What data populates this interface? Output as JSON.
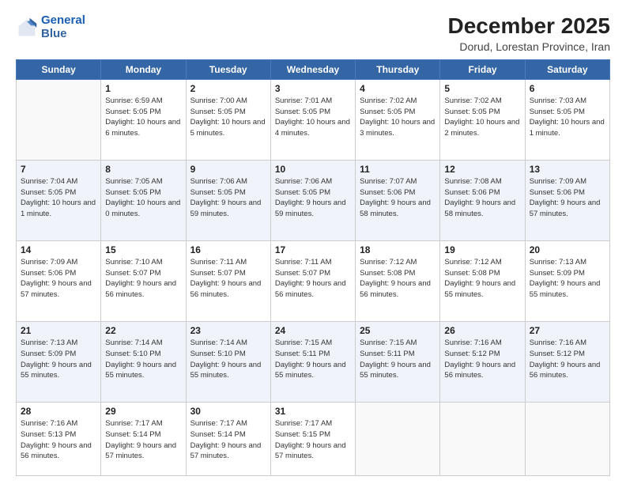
{
  "header": {
    "logo_line1": "General",
    "logo_line2": "Blue",
    "month": "December 2025",
    "location": "Dorud, Lorestan Province, Iran"
  },
  "days_of_week": [
    "Sunday",
    "Monday",
    "Tuesday",
    "Wednesday",
    "Thursday",
    "Friday",
    "Saturday"
  ],
  "weeks": [
    [
      {
        "day": null
      },
      {
        "day": "1",
        "sunrise": "6:59 AM",
        "sunset": "5:05 PM",
        "daylight": "10 hours and 6 minutes."
      },
      {
        "day": "2",
        "sunrise": "7:00 AM",
        "sunset": "5:05 PM",
        "daylight": "10 hours and 5 minutes."
      },
      {
        "day": "3",
        "sunrise": "7:01 AM",
        "sunset": "5:05 PM",
        "daylight": "10 hours and 4 minutes."
      },
      {
        "day": "4",
        "sunrise": "7:02 AM",
        "sunset": "5:05 PM",
        "daylight": "10 hours and 3 minutes."
      },
      {
        "day": "5",
        "sunrise": "7:02 AM",
        "sunset": "5:05 PM",
        "daylight": "10 hours and 2 minutes."
      },
      {
        "day": "6",
        "sunrise": "7:03 AM",
        "sunset": "5:05 PM",
        "daylight": "10 hours and 1 minute."
      }
    ],
    [
      {
        "day": "7",
        "sunrise": "7:04 AM",
        "sunset": "5:05 PM",
        "daylight": "10 hours and 1 minute."
      },
      {
        "day": "8",
        "sunrise": "7:05 AM",
        "sunset": "5:05 PM",
        "daylight": "10 hours and 0 minutes."
      },
      {
        "day": "9",
        "sunrise": "7:06 AM",
        "sunset": "5:05 PM",
        "daylight": "9 hours and 59 minutes."
      },
      {
        "day": "10",
        "sunrise": "7:06 AM",
        "sunset": "5:05 PM",
        "daylight": "9 hours and 59 minutes."
      },
      {
        "day": "11",
        "sunrise": "7:07 AM",
        "sunset": "5:06 PM",
        "daylight": "9 hours and 58 minutes."
      },
      {
        "day": "12",
        "sunrise": "7:08 AM",
        "sunset": "5:06 PM",
        "daylight": "9 hours and 58 minutes."
      },
      {
        "day": "13",
        "sunrise": "7:09 AM",
        "sunset": "5:06 PM",
        "daylight": "9 hours and 57 minutes."
      }
    ],
    [
      {
        "day": "14",
        "sunrise": "7:09 AM",
        "sunset": "5:06 PM",
        "daylight": "9 hours and 57 minutes."
      },
      {
        "day": "15",
        "sunrise": "7:10 AM",
        "sunset": "5:07 PM",
        "daylight": "9 hours and 56 minutes."
      },
      {
        "day": "16",
        "sunrise": "7:11 AM",
        "sunset": "5:07 PM",
        "daylight": "9 hours and 56 minutes."
      },
      {
        "day": "17",
        "sunrise": "7:11 AM",
        "sunset": "5:07 PM",
        "daylight": "9 hours and 56 minutes."
      },
      {
        "day": "18",
        "sunrise": "7:12 AM",
        "sunset": "5:08 PM",
        "daylight": "9 hours and 56 minutes."
      },
      {
        "day": "19",
        "sunrise": "7:12 AM",
        "sunset": "5:08 PM",
        "daylight": "9 hours and 55 minutes."
      },
      {
        "day": "20",
        "sunrise": "7:13 AM",
        "sunset": "5:09 PM",
        "daylight": "9 hours and 55 minutes."
      }
    ],
    [
      {
        "day": "21",
        "sunrise": "7:13 AM",
        "sunset": "5:09 PM",
        "daylight": "9 hours and 55 minutes."
      },
      {
        "day": "22",
        "sunrise": "7:14 AM",
        "sunset": "5:10 PM",
        "daylight": "9 hours and 55 minutes."
      },
      {
        "day": "23",
        "sunrise": "7:14 AM",
        "sunset": "5:10 PM",
        "daylight": "9 hours and 55 minutes."
      },
      {
        "day": "24",
        "sunrise": "7:15 AM",
        "sunset": "5:11 PM",
        "daylight": "9 hours and 55 minutes."
      },
      {
        "day": "25",
        "sunrise": "7:15 AM",
        "sunset": "5:11 PM",
        "daylight": "9 hours and 55 minutes."
      },
      {
        "day": "26",
        "sunrise": "7:16 AM",
        "sunset": "5:12 PM",
        "daylight": "9 hours and 56 minutes."
      },
      {
        "day": "27",
        "sunrise": "7:16 AM",
        "sunset": "5:12 PM",
        "daylight": "9 hours and 56 minutes."
      }
    ],
    [
      {
        "day": "28",
        "sunrise": "7:16 AM",
        "sunset": "5:13 PM",
        "daylight": "9 hours and 56 minutes."
      },
      {
        "day": "29",
        "sunrise": "7:17 AM",
        "sunset": "5:14 PM",
        "daylight": "9 hours and 57 minutes."
      },
      {
        "day": "30",
        "sunrise": "7:17 AM",
        "sunset": "5:14 PM",
        "daylight": "9 hours and 57 minutes."
      },
      {
        "day": "31",
        "sunrise": "7:17 AM",
        "sunset": "5:15 PM",
        "daylight": "9 hours and 57 minutes."
      },
      {
        "day": null
      },
      {
        "day": null
      },
      {
        "day": null
      }
    ]
  ]
}
